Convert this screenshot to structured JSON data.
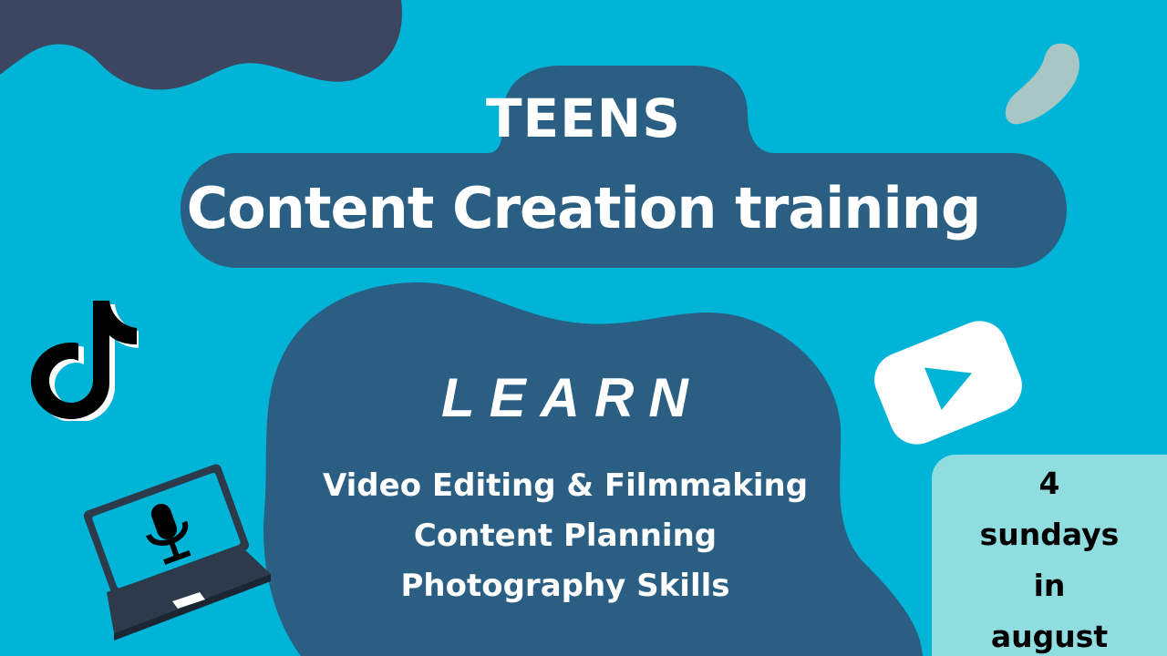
{
  "header": {
    "line1": "TEENS",
    "line2": "Content Creation training"
  },
  "learn": {
    "heading": "LEARN",
    "items": [
      "Video Editing & Filmmaking",
      "Content Planning",
      "Photography Skills"
    ]
  },
  "schedule": {
    "lines": [
      "4",
      "sundays",
      "in",
      "august"
    ]
  },
  "colors": {
    "background": "#00b4d8",
    "dark_blob": "#2a5f83",
    "top_left_blob": "#3c4660",
    "date_box": "#90dde0",
    "text": "#ffffff"
  },
  "icons": [
    "tiktok-icon",
    "youtube-play-icon",
    "laptop-microphone-icon"
  ]
}
